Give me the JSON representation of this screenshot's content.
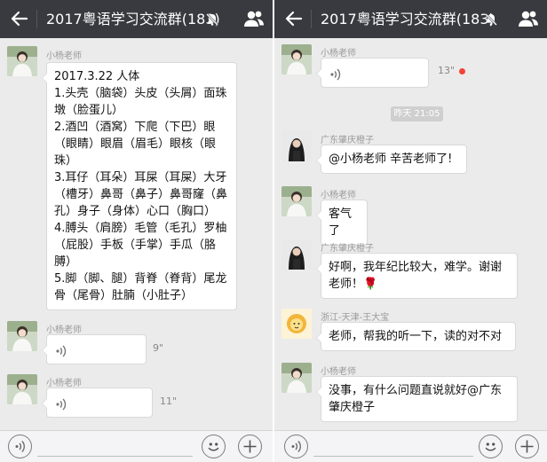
{
  "left": {
    "title": "2017粤语学习交流群(183)",
    "messages": [
      {
        "sender": "小杨老师",
        "text": "2017.3.22 人体\n1.头壳（脑袋）头皮（头屑）面珠墩（脸蛋儿）\n2.酒凹（酒窝）下爬（下巴）眼（眼睛）眼眉（眉毛）眼核（眼珠）\n3.耳仔（耳朵）耳屎（耳屎）大牙（槽牙）鼻哥（鼻子）鼻哥窿（鼻孔）身子（身体）心口（胸口）\n4.膊头（肩膀）毛管（毛孔）罗柚（屁股）手板（手掌）手瓜（胳膊）\n5.脚（脚、腿）背脊（脊背）尾龙骨（尾骨）肚腩（小肚子）"
      },
      {
        "sender": "小杨老师",
        "duration": "9\""
      },
      {
        "sender": "小杨老师",
        "duration": "11\""
      }
    ]
  },
  "right": {
    "title": "2017粤语学习交流群(183)",
    "voice_message": {
      "sender": "小杨老师",
      "duration": "13\""
    },
    "timestamp": "昨天 21:05",
    "messages": [
      {
        "sender": "广东肇庆橙子",
        "text": "@小杨老师 辛苦老师了!"
      },
      {
        "sender": "小杨老师",
        "text": "客气了"
      },
      {
        "sender": "广东肇庆橙子",
        "text": "好啊，我年纪比较大，难学。谢谢老师！🌹"
      },
      {
        "sender": "浙江-天津-王大宝",
        "text": "老师，帮我的听一下，读的对不对"
      },
      {
        "sender": "小杨老师",
        "text": "没事，有什么问题直说就好@广东肇庆橙子"
      }
    ]
  },
  "icons": {
    "back": "arrow-left-icon",
    "mute": "bell-off-icon",
    "members": "group-members-icon",
    "voice_toggle": "voice-input-icon",
    "emoji": "emoji-icon",
    "more": "plus-icon",
    "voice_wave": "voice-wave-icon"
  },
  "colors": {
    "topbar": "#393a3f",
    "chat_background": "#ebebeb",
    "bubble": "#ffffff",
    "unread_dot": "#f44336",
    "sender_name": "#9a9a9a"
  }
}
